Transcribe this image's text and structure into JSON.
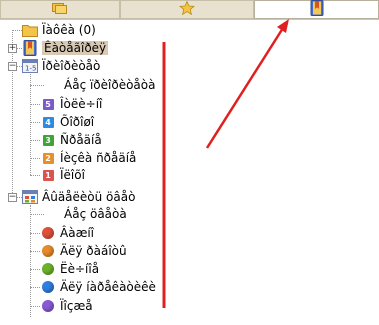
{
  "tabs": [
    {
      "icon": "folders-icon",
      "active": false
    },
    {
      "icon": "star-icon",
      "active": false
    },
    {
      "icon": "bookmark-icon",
      "active": true
    }
  ],
  "tree": {
    "root_all": "Ïàôêà (0)",
    "favorites": "Êàòåãîðèÿ",
    "priority": {
      "label": "Ïðèîðèòåò",
      "items": [
        {
          "label": "Áåç ïðèîðèòåòà",
          "badge": "",
          "color": ""
        },
        {
          "label": "Îòëè÷íî",
          "badge": "5",
          "color": "#7b5cc6"
        },
        {
          "label": "Õîðîøî",
          "badge": "4",
          "color": "#2f8be0"
        },
        {
          "label": "Ñðåäíå",
          "badge": "3",
          "color": "#3fa33a"
        },
        {
          "label": "Íèçêà ñðåäíå",
          "badge": "2",
          "color": "#e7902a"
        },
        {
          "label": "Ïëîõî",
          "badge": "1",
          "color": "#d9534f"
        }
      ]
    },
    "color": {
      "label": "Âûäåëèòü öâåò",
      "items": [
        {
          "label": "Áåç öâåòà",
          "color": ""
        },
        {
          "label": "Âàæíî",
          "color": "#e0503c"
        },
        {
          "label": "Äëÿ ðàáîòû",
          "color": "#e88a2a"
        },
        {
          "label": "Ëè÷íîå",
          "color": "#6fb22a"
        },
        {
          "label": "Äëÿ íàðåêàòèêè",
          "color": "#2f7fe0"
        },
        {
          "label": "Ïîçæå",
          "color": "#8a5ad6"
        }
      ]
    }
  },
  "annotation_color": "#e02020"
}
